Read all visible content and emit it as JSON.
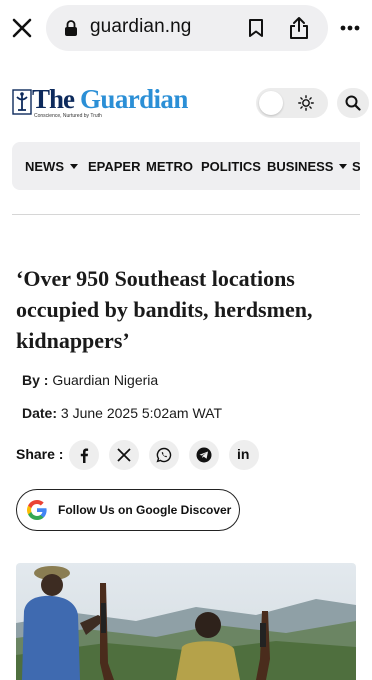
{
  "browser": {
    "url": "guardian.ng",
    "icons": [
      "close-icon",
      "lock-icon",
      "bookmark-icon",
      "share-icon",
      "more-icon"
    ]
  },
  "site": {
    "logo_the": "The",
    "logo_guardian": "Guardian",
    "tagline": "Conscience, Nurtured by Truth",
    "icons": [
      "sun-icon",
      "search-icon"
    ]
  },
  "nav": {
    "items": [
      {
        "label": "NEWS",
        "has_caret": true
      },
      {
        "label": "EPAPER",
        "has_caret": false
      },
      {
        "label": "METRO",
        "has_caret": false
      },
      {
        "label": "POLITICS",
        "has_caret": false
      },
      {
        "label": "BUSINESS",
        "has_caret": true
      },
      {
        "label": "S",
        "has_caret": false
      }
    ]
  },
  "article": {
    "headline": "‘Over 950 Southeast locations occupied by bandits, herdsmen, kidnappers’",
    "by_label": "By :",
    "author": "Guardian Nigeria",
    "date_label": "Date:",
    "date": "3 June 2025 5:02am WAT",
    "share_label": "Share :",
    "share_icons": [
      "facebook-icon",
      "x-icon",
      "whatsapp-icon",
      "telegram-icon",
      "linkedin-icon"
    ],
    "google_discover_label": "Follow Us on Google Discover"
  },
  "colors": {
    "logo_dark": "#0d2a5c",
    "logo_blue": "#2b8fd6",
    "pill_bg": "#efeff1"
  }
}
